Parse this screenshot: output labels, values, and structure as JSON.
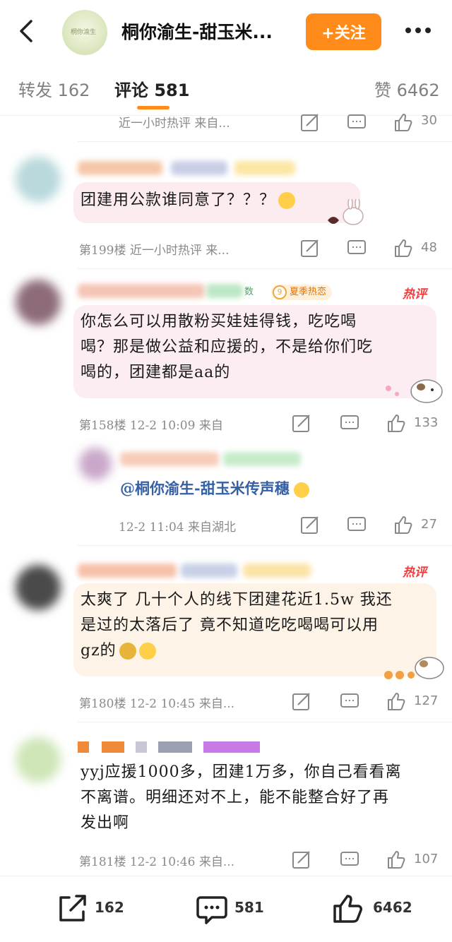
{
  "header": {
    "title": "桐你渝生-甜玉米...",
    "avatar_text": "桐你渝生",
    "follow_label": "+关注",
    "accent": "#ff8c1a"
  },
  "tabs": [
    {
      "label": "转发 162"
    },
    {
      "label": "评论 581"
    },
    {
      "label": "赞 6462"
    }
  ],
  "comments": [
    {
      "meta": "近一小时热评 来自...",
      "likes": "30"
    },
    {
      "text": "团建用公款谁同意了？？？",
      "meta": "第199楼 近一小时热评 来...",
      "likes": "48"
    },
    {
      "text_lines": [
        "你怎么可以用散粉买娃娃得钱，吃吃喝",
        "喝？那是做公益和应援的，不是给你们吃",
        "喝的，团建都是aa的"
      ],
      "meta": "第158楼 12-2 10:09 来自",
      "likes": "133",
      "badge": "夏季热恋",
      "badge_num": "9",
      "fan_tag": "数",
      "hot": "热评"
    },
    {
      "reply_mention": "@桐你渝生-甜玉米传声穗",
      "meta": "12-2 11:04 来自湖北",
      "likes": "27"
    },
    {
      "text_lines": [
        "太爽了 几十个人的线下团建花近1.5w 我还",
        "是过的太落后了 竟不知道吃吃喝喝可以用",
        "gz的"
      ],
      "meta": "第180楼 12-2 10:45 来自...",
      "likes": "127",
      "hot": "热评"
    },
    {
      "text_lines": [
        "yyj应援1000多，团建1万多，你自己看看离",
        "不离谱。明细还对不上，能不能整合好了再",
        "发出啊"
      ],
      "meta": "第181楼 12-2 10:46 来自...",
      "likes": "107"
    }
  ],
  "bottom": {
    "repost_count": "162",
    "comment_count": "581",
    "like_count": "6462"
  },
  "icons": [
    "back-arrow-icon",
    "more-icon",
    "edit-icon",
    "comment-icon",
    "thumb-up-icon",
    "share-icon"
  ]
}
